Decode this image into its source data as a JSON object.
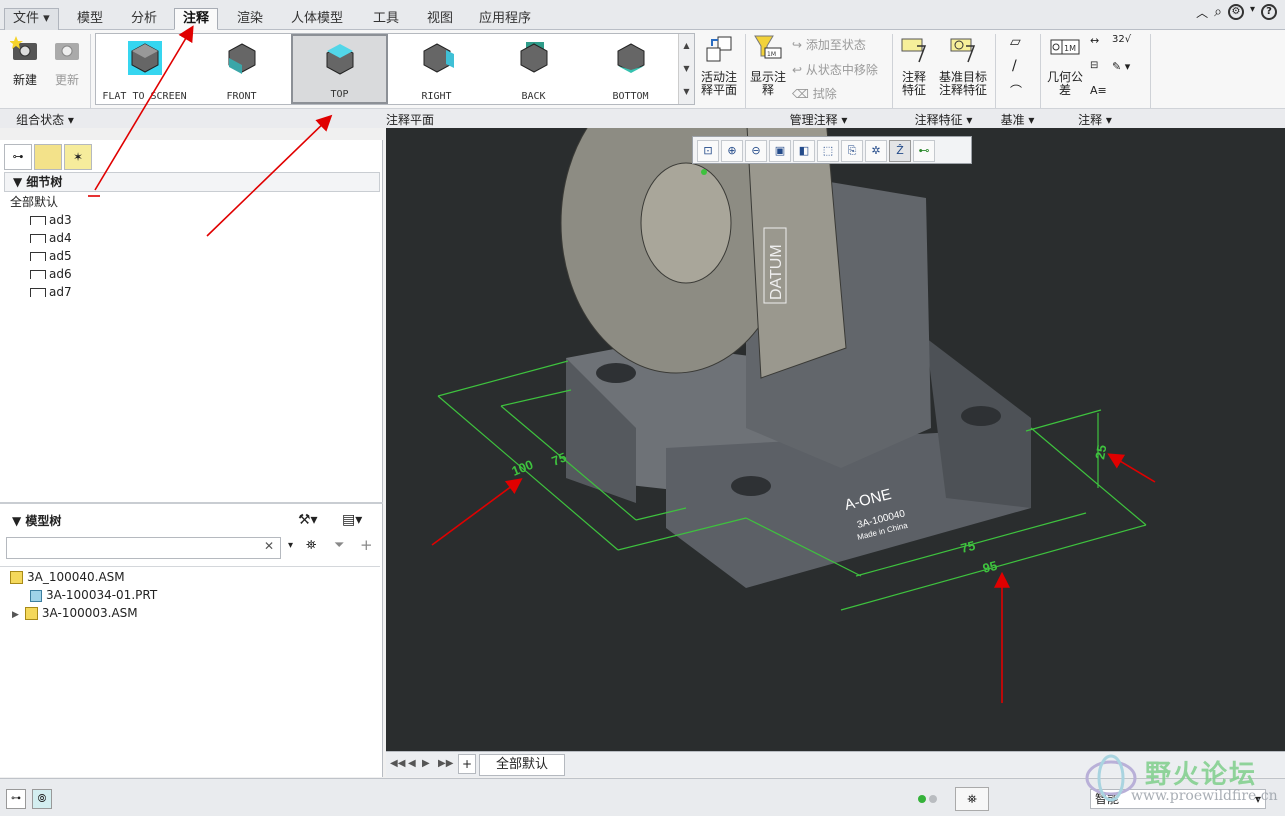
{
  "menu": {
    "file": "文件",
    "tabs": [
      "模型",
      "分析",
      "注释",
      "渲染",
      "人体模型",
      "工具",
      "视图",
      "应用程序"
    ],
    "active_tab": "注释"
  },
  "ribbon": {
    "new_label": "新建",
    "update_label": "更新",
    "gallery": [
      "FLAT TO SCREEN",
      "FRONT",
      "TOP",
      "RIGHT",
      "BACK",
      "BOTTOM"
    ],
    "gallery_selected": "TOP",
    "active_plane_label": "活动注释平面",
    "show_annotation_label": "显示注释",
    "add_to_state": "添加至状态",
    "remove_from_state": "从状态中移除",
    "erase": "拭除",
    "annotation_feature_label": "注释特征",
    "datum_target_label": "基准目标注释特征",
    "geom_tol_label": "几何公差",
    "dim_label": "32",
    "groups": {
      "combined_state": "组合状态",
      "annotation_plane": "注释平面",
      "manage_annotations": "管理注释",
      "annotation_feature": "注释特征",
      "datum": "基准",
      "annotations": "注释"
    }
  },
  "detail_tree": {
    "title": "细节树",
    "root": "全部默认",
    "items": [
      "ad3",
      "ad4",
      "ad5",
      "ad6",
      "ad7"
    ]
  },
  "model_tree": {
    "title": "模型树",
    "search_placeholder": "",
    "items": [
      {
        "name": "3A_100040.ASM",
        "type": "asm"
      },
      {
        "name": "3A-100034-01.PRT",
        "type": "prt"
      },
      {
        "name": "3A-100003.ASM",
        "type": "asm"
      }
    ]
  },
  "viewport": {
    "dimensions": [
      "100",
      "75",
      "75",
      "95",
      "25"
    ],
    "brand": "A-ONE",
    "part_no": "3A-100040",
    "made_in": "Made in China",
    "datum_label": "DATUM"
  },
  "view_tab": "全部默认",
  "status": {
    "filter": "智能"
  },
  "watermark": {
    "title": "野火论坛",
    "url": "www.proewildfire.cn"
  },
  "colors": {
    "accent_green": "#3ec23e",
    "annotation_red": "#e00000",
    "viewport_bg": "#2a2d2e"
  }
}
